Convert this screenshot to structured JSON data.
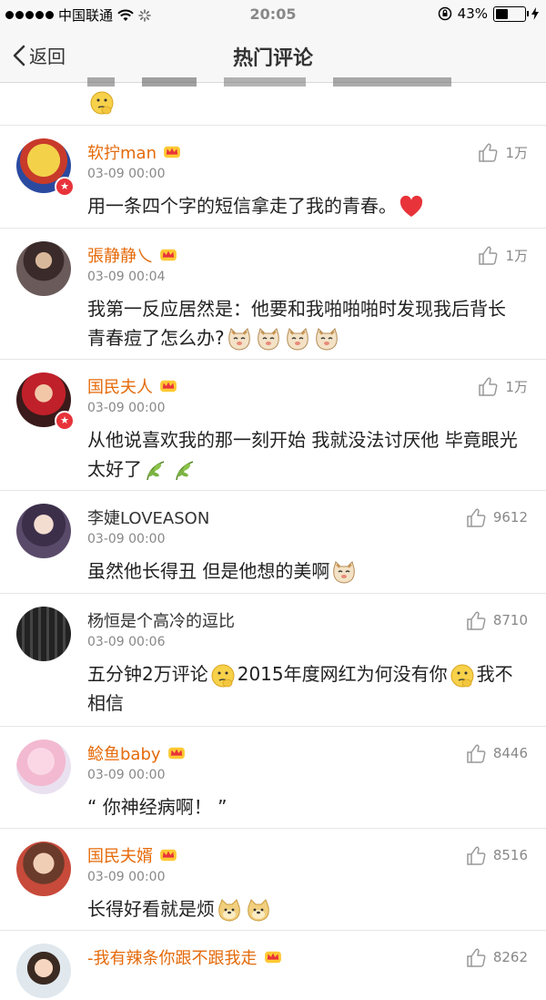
{
  "status_bar": {
    "carrier": "中国联通",
    "time": "20:05",
    "battery": "43%",
    "battery_level": 0.43
  },
  "nav": {
    "back_label": "返回",
    "title": "热门评论"
  },
  "comments": [
    {
      "name": "软拧man",
      "vip": true,
      "time": "03-09 00:00",
      "likes": "1万",
      "text": "用一条四个字的短信拿走了我的青春。"
    },
    {
      "name": "張静静乀",
      "vip": true,
      "time": "03-09 00:04",
      "likes": "1万",
      "text": "我第一反应居然是：他要和我啪啪啪时发现我后背长青春痘了怎么办?"
    },
    {
      "name": "国民夫人",
      "vip": true,
      "time": "03-09 00:00",
      "likes": "1万",
      "text": "从他说喜欢我的那一刻开始 我就没法讨厌他 毕竟眼光太好了"
    },
    {
      "name": "李婕LOVEASON",
      "vip": false,
      "time": "03-09 00:00",
      "likes": "9612",
      "text": "虽然他长得丑 但是他想的美啊"
    },
    {
      "name": "杨恒是个高冷的逗比",
      "vip": false,
      "time": "03-09 00:06",
      "likes": "8710",
      "text_a": "五分钟2万评论",
      "text_b": "2015年度网红为何没有你",
      "text_c": "我不相信"
    },
    {
      "name": "鲶鱼baby",
      "vip": true,
      "time": "03-09 00:00",
      "likes": "8446",
      "text": "“ 你神经病啊！ ”"
    },
    {
      "name": "国民夫婿",
      "vip": true,
      "time": "03-09 00:00",
      "likes": "8516",
      "text": "长得好看就是烦"
    },
    {
      "name": "-我有辣条你跟不跟我走",
      "vip": true,
      "likes": "8262"
    }
  ]
}
